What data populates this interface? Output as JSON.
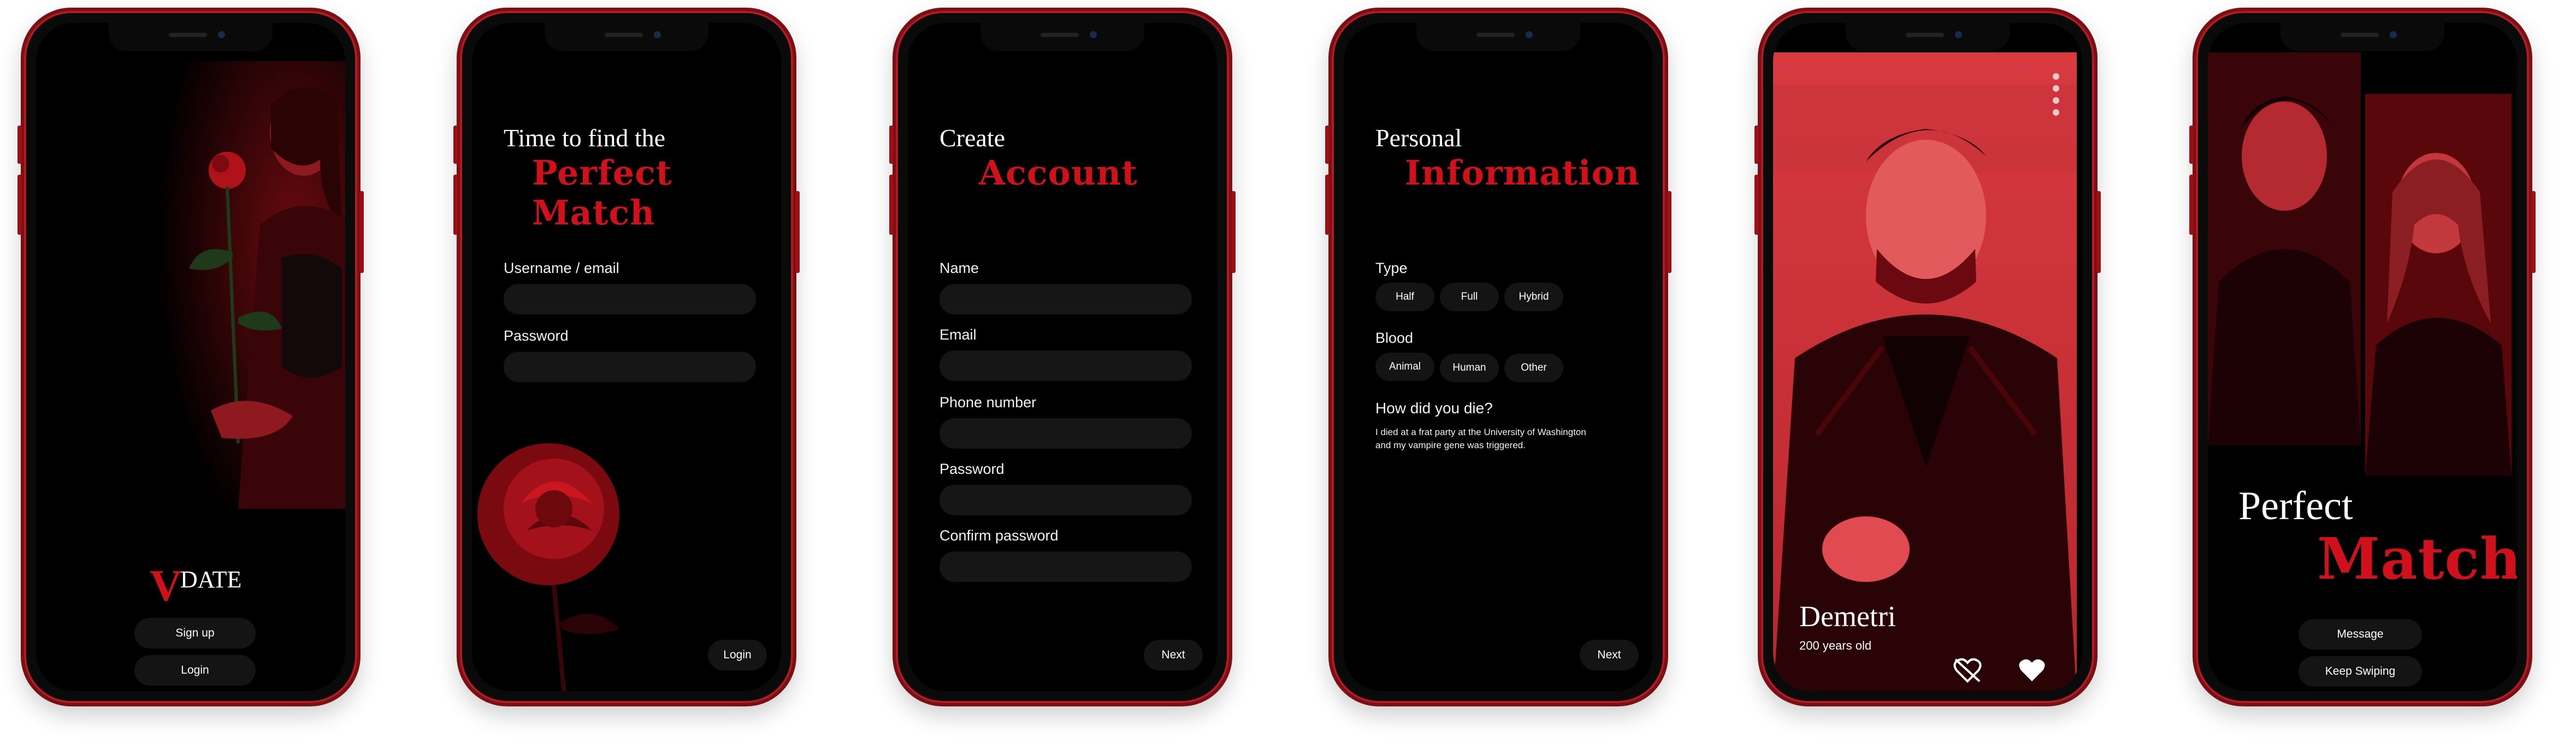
{
  "colors": {
    "accent": "#d0101a",
    "bg": "#000000",
    "frame": "#b31b22"
  },
  "screen1": {
    "logo_v": "V",
    "logo_word": "DATE",
    "signup_label": "Sign up",
    "login_label": "Login"
  },
  "screen2": {
    "title_line1": "Time to find the",
    "title_line2": "Perfect Match",
    "username_label": "Username / email",
    "password_label": "Password",
    "login_label": "Login"
  },
  "screen3": {
    "title_line1": "Create",
    "title_line2": "Account",
    "fields": [
      "Name",
      "Email",
      "Phone number",
      "Password",
      "Confirm password"
    ],
    "next_label": "Next"
  },
  "screen4": {
    "title_line1": "Personal",
    "title_line2": "Information",
    "type_label": "Type",
    "type_options": [
      "Half",
      "Full",
      "Hybrid"
    ],
    "blood_label": "Blood",
    "blood_options": [
      "Animal",
      "Human",
      "Other"
    ],
    "question": "How did you die?",
    "answer_line1": "I died at a frat party at the University of Washington",
    "answer_line2": "and my vampire gene was triggered.",
    "next_label": "Next"
  },
  "screen5": {
    "name": "Demetri",
    "age": "200 years old",
    "menu_icon": "more-vertical-icon",
    "dislike_icon": "broken-heart-icon",
    "like_icon": "heart-icon"
  },
  "screen6": {
    "title_line1": "Perfect",
    "title_line2": "Match",
    "message_label": "Message",
    "keep_swiping_label": "Keep Swiping"
  }
}
